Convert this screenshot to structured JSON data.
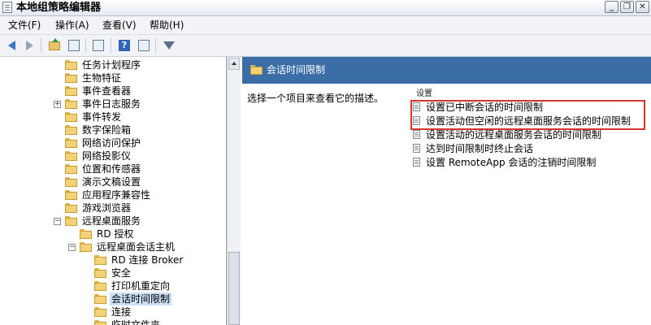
{
  "window": {
    "title": "本地组策略编辑器",
    "buttons": [
      "_",
      "❐",
      "✕"
    ]
  },
  "menu": [
    "文件(F)",
    "操作(A)",
    "查看(V)",
    "帮助(H)"
  ],
  "tree": [
    {
      "label": "任务计划程序",
      "expander": ""
    },
    {
      "label": "生物特征",
      "expander": ""
    },
    {
      "label": "事件查看器",
      "expander": ""
    },
    {
      "label": "事件日志服务",
      "expander": "+"
    },
    {
      "label": "事件转发",
      "expander": ""
    },
    {
      "label": "数字保险箱",
      "expander": ""
    },
    {
      "label": "网络访问保护",
      "expander": ""
    },
    {
      "label": "网络投影仪",
      "expander": ""
    },
    {
      "label": "位置和传感器",
      "expander": ""
    },
    {
      "label": "演示文稿设置",
      "expander": ""
    },
    {
      "label": "应用程序兼容性",
      "expander": ""
    },
    {
      "label": "游戏浏览器",
      "expander": ""
    },
    {
      "label": "远程桌面服务",
      "expander": "−"
    },
    {
      "label": "RD 授权",
      "expander": ""
    },
    {
      "label": "远程桌面会话主机",
      "expander": "−"
    },
    {
      "label": "RD 连接 Broker",
      "expander": ""
    },
    {
      "label": "安全",
      "expander": ""
    },
    {
      "label": "打印机重定向",
      "expander": ""
    },
    {
      "label": "会话时间限制",
      "expander": "",
      "selected": true
    },
    {
      "label": "连接",
      "expander": ""
    },
    {
      "label": "临时文件夹",
      "expander": ""
    }
  ],
  "right": {
    "title": "会话时间限制",
    "description": "选择一个项目来查看它的描述。",
    "column_header": "设置",
    "settings": [
      "设置已中断会话的时间限制",
      "设置活动但空闲的远程桌面服务会话的时间限制",
      "设置活动的远程桌面服务会话的时间限制",
      "达到时间限制时终止会话",
      "设置 RemoteApp 会话的注销时间限制"
    ]
  },
  "colors": {
    "header_blue": "#3b6ea7",
    "highlight_red": "#d9342b",
    "selection": "#cde0f7"
  }
}
